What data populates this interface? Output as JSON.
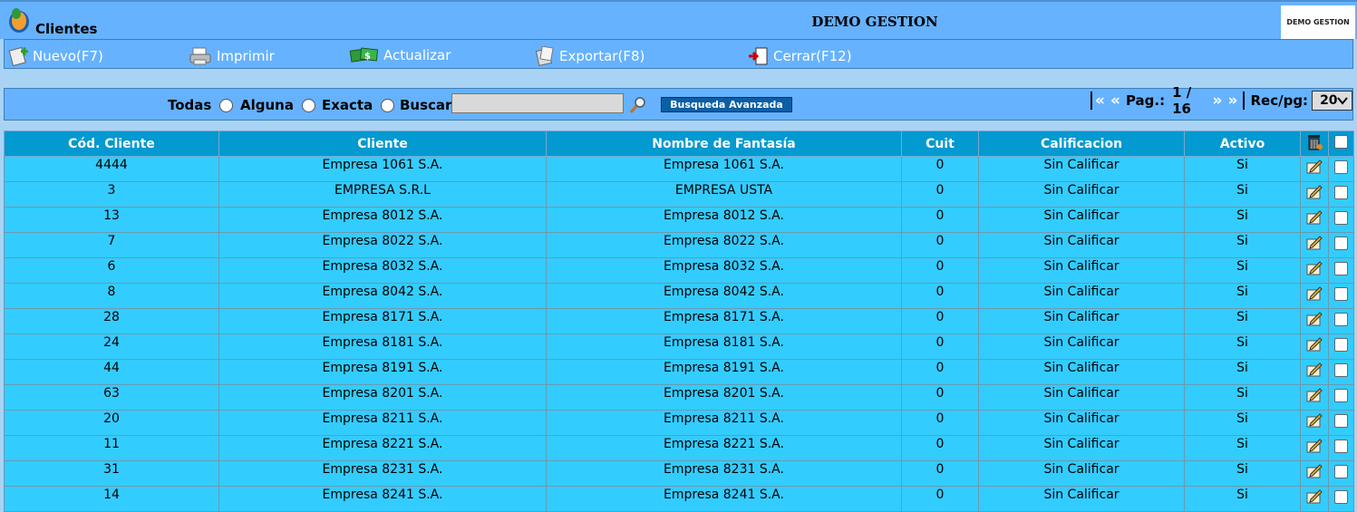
{
  "app": {
    "title": "Clientes",
    "company": "DEMO GESTION",
    "brand_text": "DEMO GESTION"
  },
  "toolbar": {
    "nuevo": "Nuevo(F7)",
    "imprimir": "Imprimir",
    "actualizar": "Actualizar",
    "exportar": "Exportar(F8)",
    "cerrar": "Cerrar(F12)"
  },
  "search": {
    "todas": "Todas",
    "alguna": "Alguna",
    "exacta": "Exacta",
    "buscar": "Buscar",
    "value": "",
    "advanced": "Busqueda Avanzada"
  },
  "pager": {
    "first": "«",
    "prev": "«",
    "label": "Pag.:",
    "page": "1 / 16",
    "next": "»",
    "last": "»",
    "rec_label": "Rec/pg:",
    "rec_value": "20"
  },
  "table": {
    "headers": [
      "Cód. Cliente",
      "Cliente",
      "Nombre de Fantasía",
      "Cuit",
      "Calificacion",
      "Activo"
    ],
    "rows": [
      [
        "4444",
        "Empresa 1061 S.A.",
        "Empresa 1061 S.A.",
        "0",
        "Sin Calificar",
        "Si"
      ],
      [
        "3",
        "EMPRESA S.R.L",
        "EMPRESA USTA",
        "0",
        "Sin Calificar",
        "Si"
      ],
      [
        "13",
        "Empresa 8012 S.A.",
        "Empresa 8012 S.A.",
        "0",
        "Sin Calificar",
        "Si"
      ],
      [
        "7",
        "Empresa 8022 S.A.",
        "Empresa 8022 S.A.",
        "0",
        "Sin Calificar",
        "Si"
      ],
      [
        "6",
        "Empresa 8032 S.A.",
        "Empresa 8032 S.A.",
        "0",
        "Sin Calificar",
        "Si"
      ],
      [
        "8",
        "Empresa 8042 S.A.",
        "Empresa 8042 S.A.",
        "0",
        "Sin Calificar",
        "Si"
      ],
      [
        "28",
        "Empresa 8171 S.A.",
        "Empresa 8171 S.A.",
        "0",
        "Sin Calificar",
        "Si"
      ],
      [
        "24",
        "Empresa 8181 S.A.",
        "Empresa 8181 S.A.",
        "0",
        "Sin Calificar",
        "Si"
      ],
      [
        "44",
        "Empresa 8191 S.A.",
        "Empresa 8191 S.A.",
        "0",
        "Sin Calificar",
        "Si"
      ],
      [
        "63",
        "Empresa 8201 S.A.",
        "Empresa 8201 S.A.",
        "0",
        "Sin Calificar",
        "Si"
      ],
      [
        "20",
        "Empresa 8211 S.A.",
        "Empresa 8211 S.A.",
        "0",
        "Sin Calificar",
        "Si"
      ],
      [
        "11",
        "Empresa 8221 S.A.",
        "Empresa 8221 S.A.",
        "0",
        "Sin Calificar",
        "Si"
      ],
      [
        "31",
        "Empresa 8231 S.A.",
        "Empresa 8231 S.A.",
        "0",
        "Sin Calificar",
        "Si"
      ],
      [
        "14",
        "Empresa 8241 S.A.",
        "Empresa 8241 S.A.",
        "0",
        "Sin Calificar",
        "Si"
      ]
    ]
  }
}
